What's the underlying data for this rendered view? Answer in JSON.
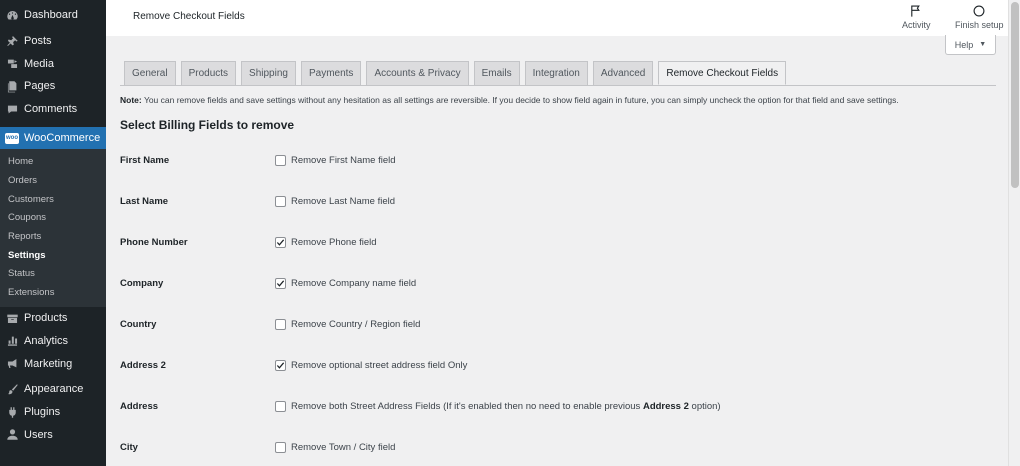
{
  "sidebar": {
    "top_items": [
      {
        "label": "Dashboard",
        "icon": "dashboard-icon"
      },
      {
        "label": "Posts",
        "icon": "pin-icon"
      },
      {
        "label": "Media",
        "icon": "media-icon"
      },
      {
        "label": "Pages",
        "icon": "pages-icon"
      },
      {
        "label": "Comments",
        "icon": "comment-icon"
      }
    ],
    "woocommerce": {
      "label": "WooCommerce",
      "badge": "woo",
      "submenu": [
        "Home",
        "Orders",
        "Customers",
        "Coupons",
        "Reports",
        "Settings",
        "Status",
        "Extensions"
      ],
      "active_submenu": "Settings"
    },
    "bottom_items": [
      {
        "label": "Products",
        "icon": "archive-icon"
      },
      {
        "label": "Analytics",
        "icon": "chart-icon"
      },
      {
        "label": "Marketing",
        "icon": "megaphone-icon"
      },
      {
        "label": "Appearance",
        "icon": "brush-icon"
      },
      {
        "label": "Plugins",
        "icon": "plugin-icon"
      },
      {
        "label": "Users",
        "icon": "user-icon"
      }
    ]
  },
  "header": {
    "title": "Remove Checkout Fields",
    "activity_label": "Activity",
    "finish_setup_label": "Finish setup",
    "help_label": "Help"
  },
  "tabs": [
    {
      "label": "General",
      "active": false
    },
    {
      "label": "Products",
      "active": false
    },
    {
      "label": "Shipping",
      "active": false
    },
    {
      "label": "Payments",
      "active": false
    },
    {
      "label": "Accounts & Privacy",
      "active": false
    },
    {
      "label": "Emails",
      "active": false
    },
    {
      "label": "Integration",
      "active": false
    },
    {
      "label": "Advanced",
      "active": false
    },
    {
      "label": "Remove Checkout Fields",
      "active": true
    }
  ],
  "note": {
    "prefix": "Note:",
    "text": " You can remove fields and save settings without any hesitation as all settings are reversible. If you decide to show field again in future, you can simply uncheck the option for that field and save settings."
  },
  "section_title": "Select Billing Fields to remove",
  "fields": [
    {
      "label": "First Name",
      "option": "Remove First Name field",
      "checked": false
    },
    {
      "label": "Last Name",
      "option": "Remove Last Name field",
      "checked": false
    },
    {
      "label": "Phone Number",
      "option": "Remove Phone field",
      "checked": true
    },
    {
      "label": "Company",
      "option": "Remove Company name field",
      "checked": true
    },
    {
      "label": "Country",
      "option": "Remove Country / Region field",
      "checked": false
    },
    {
      "label": "Address 2",
      "option": "Remove optional street address field Only",
      "checked": true
    },
    {
      "label": "Address",
      "option": "Remove both Street Address Fields (If it's enabled then no need to enable previous ",
      "option_bold": "Address 2",
      "option_suffix": " option)",
      "checked": false
    },
    {
      "label": "City",
      "option": "Remove Town / City field",
      "checked": false
    }
  ],
  "colors": {
    "sidebar_bg": "#1d2327",
    "accent": "#2271b1",
    "submenu_bg": "#2c3338",
    "page_bg": "#f0f0f1"
  }
}
